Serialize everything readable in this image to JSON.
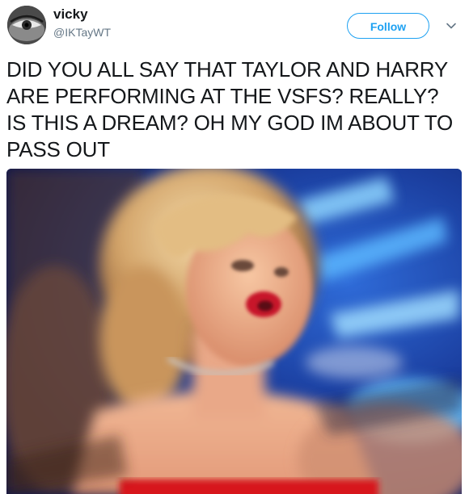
{
  "user": {
    "display_name": "vicky",
    "handle": "@IKTayWT",
    "avatar_icon": "avatar-eye-photo"
  },
  "follow_button": {
    "label": "Follow"
  },
  "menu": {
    "icon": "chevron-down-icon"
  },
  "tweet": {
    "text": "DID YOU ALL SAY THAT TAYLOR AND HARRY ARE PERFORMING AT THE VSFS? REALLY? IS THIS A DREAM? OH MY GOD IM ABOUT TO PASS OUT"
  },
  "colors": {
    "accent": "#1da1f2",
    "text": "#14171a",
    "secondary": "#657786"
  }
}
